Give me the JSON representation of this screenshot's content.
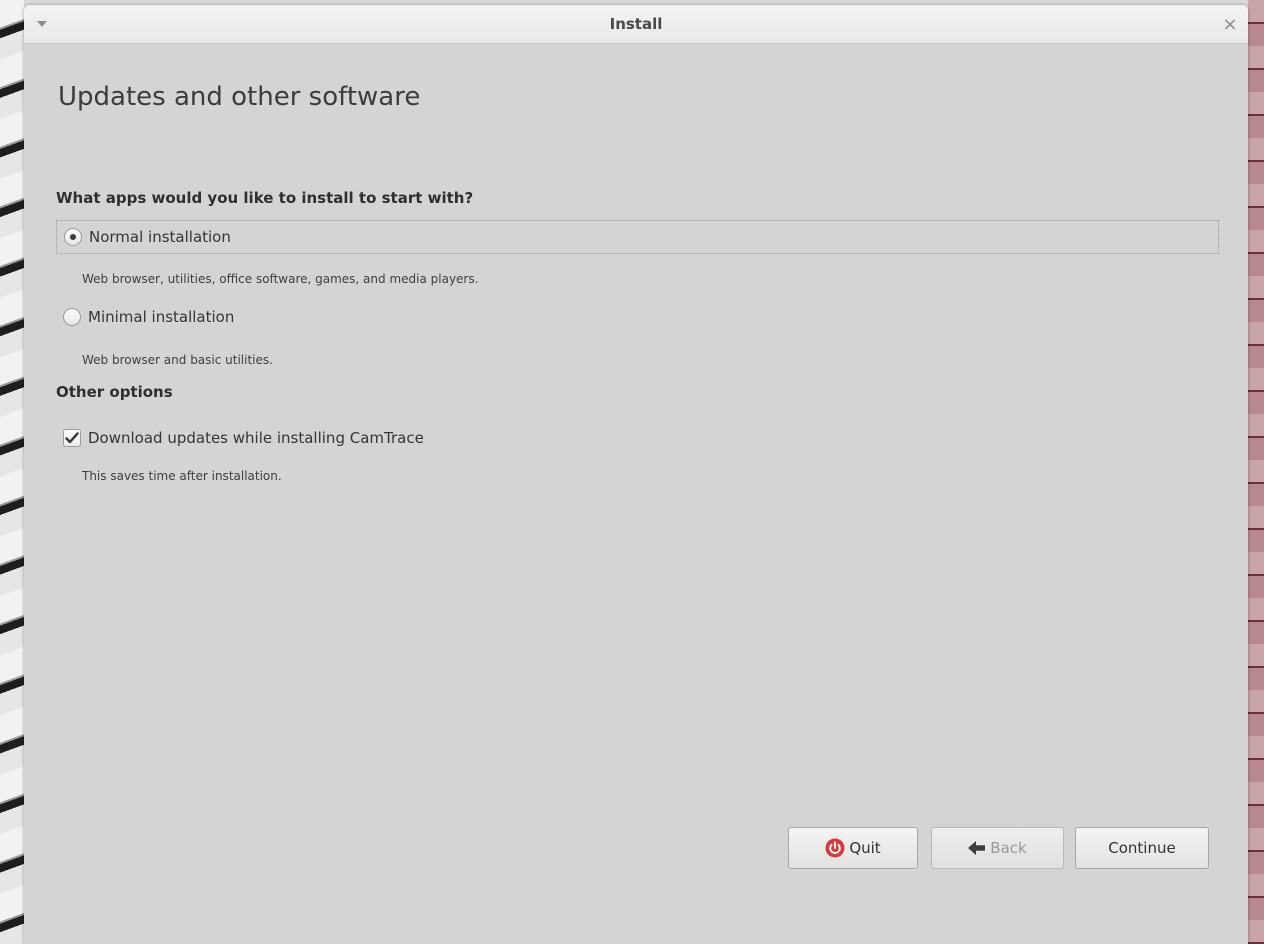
{
  "window": {
    "title": "Install",
    "menu_icon": "dropdown-arrow-icon",
    "close_icon": "close-icon",
    "close_glyph": "×"
  },
  "page": {
    "title": "Updates and other software"
  },
  "apps_section": {
    "heading": "What apps would you like to install to start with?",
    "options": [
      {
        "label": "Normal installation",
        "description": "Web browser, utilities, office software, games, and media players.",
        "selected": true
      },
      {
        "label": "Minimal installation",
        "description": "Web browser and basic utilities.",
        "selected": false
      }
    ]
  },
  "other_section": {
    "heading": "Other options",
    "options": [
      {
        "label": "Download updates while installing CamTrace",
        "description": "This saves time after installation.",
        "checked": true
      }
    ]
  },
  "buttons": {
    "quit": {
      "label": "Quit",
      "icon": "power-icon",
      "icon_color": "#d83a3a",
      "enabled": true
    },
    "back": {
      "label": "Back",
      "icon": "arrow-left-icon",
      "enabled": false
    },
    "continue": {
      "label": "Continue",
      "enabled": true
    }
  }
}
